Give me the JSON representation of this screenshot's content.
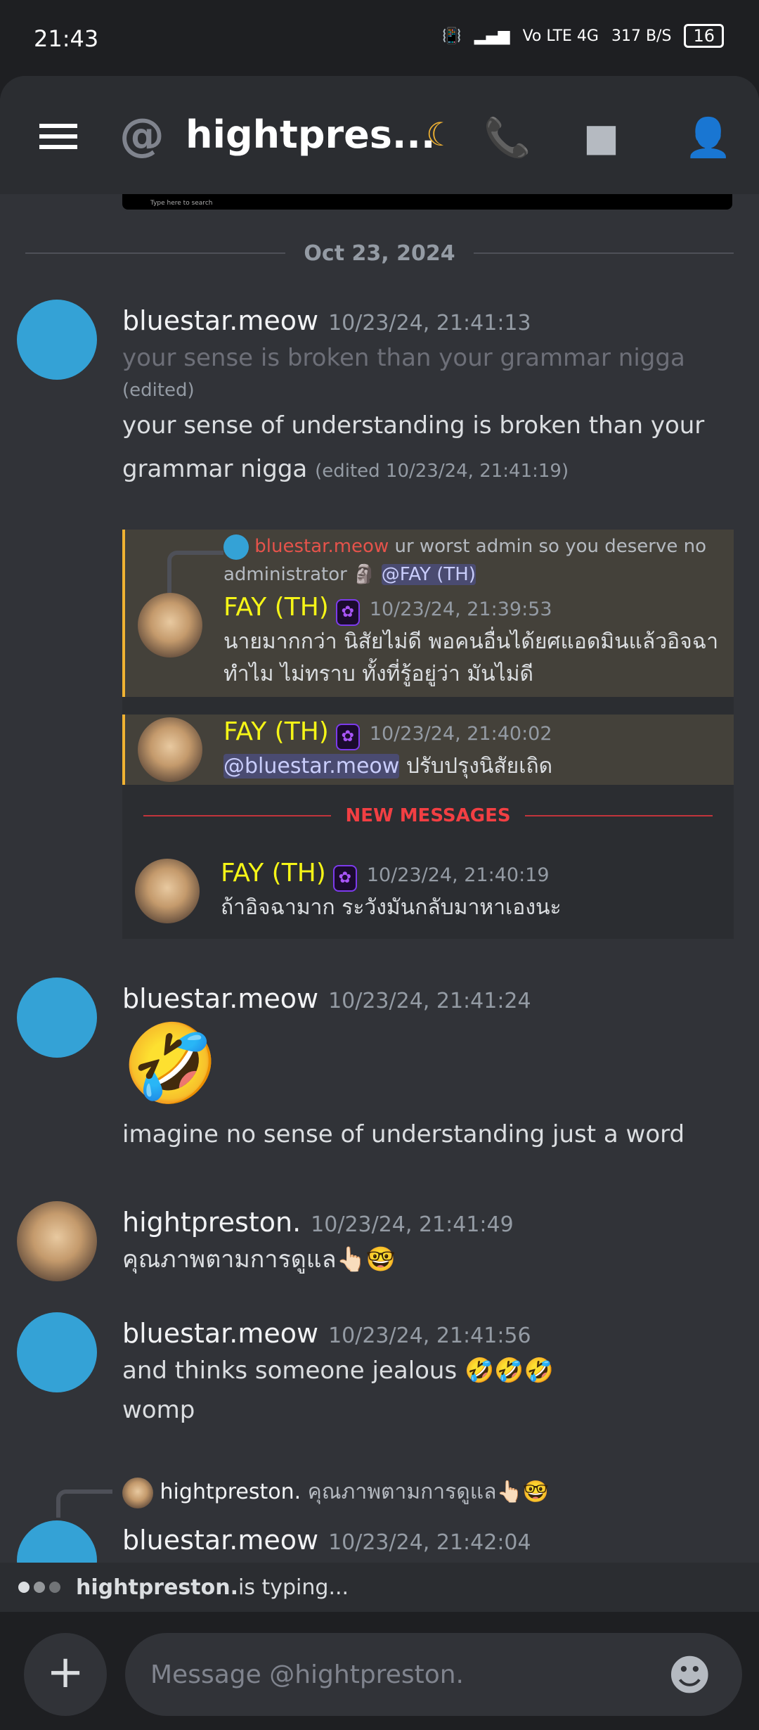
{
  "status_bar": {
    "time": "21:43",
    "network": "Vo LTE 4G",
    "speed": "317 B/S",
    "battery": "16"
  },
  "header": {
    "title": "hightpres...",
    "status_icon": "moon-icon",
    "icons": [
      "voice-call-icon",
      "video-call-icon",
      "members-icon"
    ]
  },
  "screenshot_strip": {
    "text": "Type here to search"
  },
  "date_divider": "Oct 23, 2024",
  "messages": [
    {
      "author": "bluestar.meow",
      "timestamp": "10/23/24, 21:41:13",
      "old_text": "your sense is broken than your grammar nigga",
      "edited_label": "(edited)",
      "text": "your sense of understanding is broken than your grammar nigga",
      "edited_note": "(edited 10/23/24, 21:41:19)"
    },
    {
      "author": "bluestar.meow",
      "timestamp": "10/23/24, 21:41:24",
      "emoji": "🤣",
      "text": "imagine no sense of understanding just a word"
    },
    {
      "author": "hightpreston.",
      "timestamp": "10/23/24, 21:41:49",
      "text": "คุณภาพตามการดูแล👆🏻🤓"
    },
    {
      "author": "bluestar.meow",
      "timestamp": "10/23/24, 21:41:56",
      "text": "and thinks someone jealous 🤣🤣🤣",
      "text2": "womp"
    },
    {
      "reply_author": "hightpreston.",
      "reply_text": "คุณภาพตามการดูแล👆🏻🤓",
      "author": "bluestar.meow",
      "timestamp": "10/23/24, 21:42:04"
    }
  ],
  "embed": {
    "reply": {
      "author": "bluestar.meow",
      "text": "ur worst admin so you deserve no administrator 🗿",
      "mention": "@FAY (TH)"
    },
    "messages": [
      {
        "author": "FAY (TH)",
        "timestamp": "10/23/24, 21:39:53",
        "text": "นายมากกว่า นิสัยไม่ดี พอคนอื่นได้ยศแอดมินแล้วอิจฉาทำไม ไม่ทราบ ทั้งที่รู้อยู่ว่า มันไม่ดี"
      },
      {
        "author": "FAY (TH)",
        "timestamp": "10/23/24, 21:40:02",
        "mention": "@bluestar.meow",
        "text": " ปรับปรุงนิสัยเถิด"
      },
      {
        "author": "FAY (TH)",
        "timestamp": "10/23/24, 21:40:19",
        "text": "ถ้าอิจฉามาก ระวังมันกลับมาหาเองนะ"
      }
    ],
    "new_messages_label": "NEW MESSAGES"
  },
  "typing": {
    "user": "hightpreston.",
    "suffix": " is typing..."
  },
  "composer": {
    "placeholder": "Message @hightpreston."
  },
  "colors": {
    "background": "#313338",
    "accent_yellow": "#f5f517",
    "new_messages": "#f23f43",
    "avatar_blue": "#34a2d6"
  }
}
